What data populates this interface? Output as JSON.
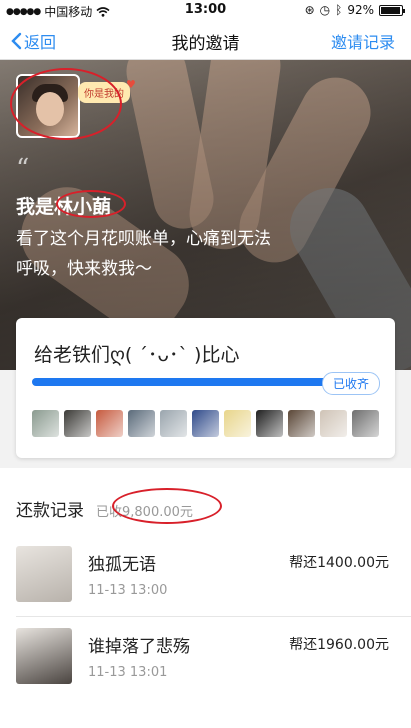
{
  "status_bar": {
    "carrier": "中国移动",
    "time": "13:00",
    "battery": "92%",
    "icons": [
      "signal-icon",
      "wifi-icon",
      "lock-rotation-icon",
      "alarm-icon",
      "bluetooth-icon",
      "battery-icon"
    ]
  },
  "nav": {
    "back_label": "返回",
    "title": "我的邀请",
    "records_label": "邀请记录"
  },
  "hero": {
    "bubble_text": "你是我的",
    "quote": "“",
    "name_line": "我是林小蓢",
    "message": "看了这个月花呗账单，心痛到无法呼吸，快来救我～"
  },
  "card": {
    "title": "给老铁们ღ( ´･ᴗ･` )比心",
    "progress": 1.0,
    "collected_label": "已收齐",
    "friends": [
      "#8a9a8f",
      "#3b3a36",
      "#c65a3e",
      "#5a6a7a",
      "#9aa5ad",
      "#2f4a8a",
      "#e8d58a",
      "#1f1f1f",
      "#5a4636",
      "#cfc3b6",
      "#6e6e6e"
    ]
  },
  "records": {
    "label": "还款记录",
    "total": "已收9,800.00元",
    "items": [
      {
        "name": "独孤无语",
        "time": "11-13 13:00",
        "amount": "帮还1400.00元",
        "photo_color": "#b8b2ab"
      },
      {
        "name": "谁掉落了悲殇",
        "time": "11-13 13:01",
        "amount": "帮还1960.00元",
        "photo_color": "#4a4440"
      }
    ]
  },
  "colors": {
    "accent": "#2d8cf0",
    "progress": "#1e78f0",
    "annotation_ring": "#d8202a"
  }
}
